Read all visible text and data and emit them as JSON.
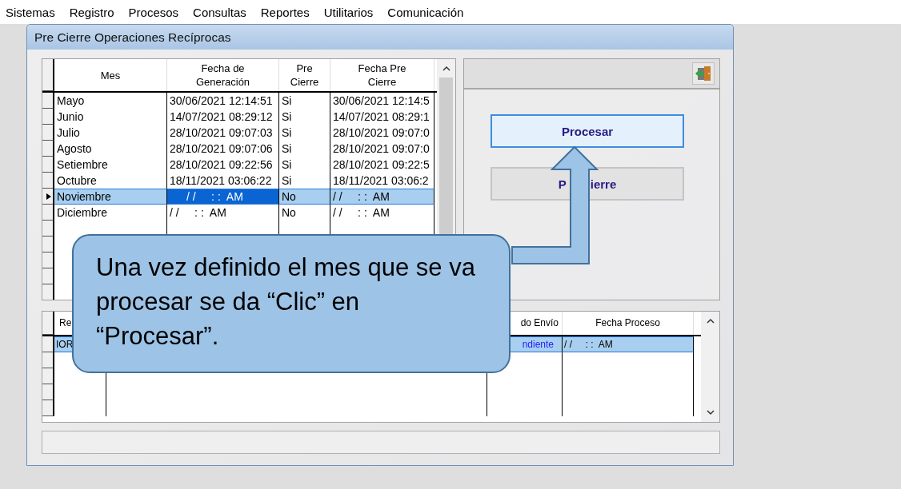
{
  "menu": [
    "Sistemas",
    "Registro",
    "Procesos",
    "Consultas",
    "Reportes",
    "Utilitarios",
    "Comunicación"
  ],
  "window": {
    "title": "Pre Cierre Operaciones Recíprocas"
  },
  "top_grid": {
    "columns": [
      "Mes",
      "Fecha de\nGeneración",
      "Pre\nCierre",
      "Fecha  Pre\nCierre"
    ],
    "rows": [
      {
        "mes": "Mayo",
        "fecha_generacion": "30/06/2021 12:14:51",
        "pre_cierre": "Si",
        "fecha_pre_cierre": "30/06/2021 12:14:5",
        "selected": false
      },
      {
        "mes": "Junio",
        "fecha_generacion": "14/07/2021 08:29:12",
        "pre_cierre": "Si",
        "fecha_pre_cierre": "14/07/2021 08:29:1",
        "selected": false
      },
      {
        "mes": "Julio",
        "fecha_generacion": "28/10/2021 09:07:03",
        "pre_cierre": "Si",
        "fecha_pre_cierre": "28/10/2021 09:07:0",
        "selected": false
      },
      {
        "mes": "Agosto",
        "fecha_generacion": "28/10/2021 09:07:06",
        "pre_cierre": "Si",
        "fecha_pre_cierre": "28/10/2021 09:07:0",
        "selected": false
      },
      {
        "mes": "Setiembre",
        "fecha_generacion": "28/10/2021 09:22:56",
        "pre_cierre": "Si",
        "fecha_pre_cierre": "28/10/2021 09:22:5",
        "selected": false
      },
      {
        "mes": "Octubre",
        "fecha_generacion": "18/11/2021 03:06:22",
        "pre_cierre": "Si",
        "fecha_pre_cierre": "18/11/2021 03:06:2",
        "selected": false
      },
      {
        "mes": "Noviembre",
        "fecha_generacion": "/ /     : :  AM",
        "pre_cierre": "No",
        "fecha_pre_cierre": "/ /     : :  AM",
        "selected": true
      },
      {
        "mes": "Diciembre",
        "fecha_generacion": "/ /     : :  AM",
        "pre_cierre": "No",
        "fecha_pre_cierre": "/ /     : :  AM",
        "selected": false
      }
    ]
  },
  "buttons": [
    {
      "texts": [
        "Procesar"
      ],
      "focused": true
    },
    {
      "texts": [
        "P",
        "ierre"
      ],
      "focused": false
    }
  ],
  "bottom_grid": {
    "columns": [
      {
        "label": "Re"
      },
      {},
      {
        "label": "do Envío"
      },
      {
        "label": "Fecha Proceso"
      }
    ],
    "rows": [
      {
        "column_1": "IOR",
        "column_3": "ndiente",
        "column_4": "/ /     : :  AM",
        "selected": true
      }
    ]
  },
  "callout": {
    "text": "Una vez definido el mes que se va procesar se da “Clic” en “Procesar”."
  }
}
